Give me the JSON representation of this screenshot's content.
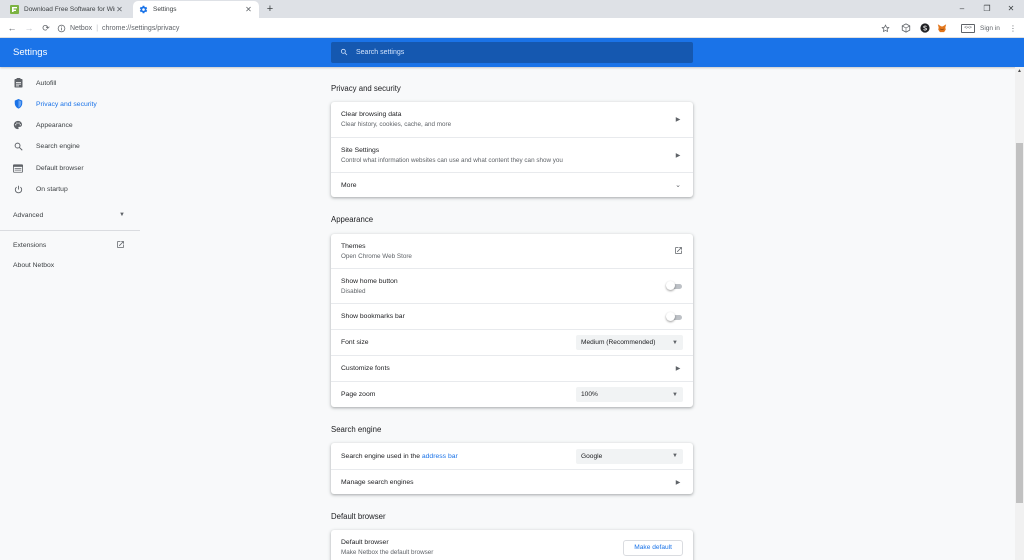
{
  "tabs": [
    {
      "title": "Download Free Software for Wind",
      "close": "✕"
    },
    {
      "title": "Settings",
      "close": "✕"
    }
  ],
  "new_tab": "+",
  "window_controls": {
    "minimize": "–",
    "restore": "❐",
    "close": "✕"
  },
  "toolbar": {
    "back": "←",
    "forward": "→",
    "reload": "⟳",
    "site_name": "Netbox",
    "separator": "|",
    "url": "chrome://settings/privacy",
    "sign_in": "Sign in",
    "menu": "⋮"
  },
  "header": {
    "title": "Settings",
    "search_placeholder": "Search settings"
  },
  "sidebar": {
    "items": [
      {
        "label": "Autofill",
        "icon": "clipboard-icon"
      },
      {
        "label": "Privacy and security",
        "icon": "shield-icon"
      },
      {
        "label": "Appearance",
        "icon": "palette-icon"
      },
      {
        "label": "Search engine",
        "icon": "search-icon"
      },
      {
        "label": "Default browser",
        "icon": "browser-icon"
      },
      {
        "label": "On startup",
        "icon": "power-icon"
      }
    ],
    "advanced": "Advanced",
    "extensions": "Extensions",
    "about": "About Netbox"
  },
  "privacy": {
    "title": "Privacy and security",
    "clear_browsing": {
      "primary": "Clear browsing data",
      "secondary": "Clear history, cookies, cache, and more"
    },
    "site_settings": {
      "primary": "Site Settings",
      "secondary": "Control what information websites can use and what content they can show you"
    },
    "more": "More"
  },
  "appearance": {
    "title": "Appearance",
    "themes": {
      "primary": "Themes",
      "secondary": "Open Chrome Web Store"
    },
    "home_button": {
      "primary": "Show home button",
      "secondary": "Disabled",
      "enabled": false
    },
    "bookmarks_bar": {
      "primary": "Show bookmarks bar",
      "enabled": false
    },
    "font_size": {
      "label": "Font size",
      "value": "Medium (Recommended)"
    },
    "customize_fonts": "Customize fonts",
    "page_zoom": {
      "label": "Page zoom",
      "value": "100%"
    }
  },
  "search_engine": {
    "title": "Search engine",
    "used_prefix": "Search engine used in the ",
    "used_link": "address bar",
    "value": "Google",
    "manage": "Manage search engines"
  },
  "default_browser": {
    "title": "Default browser",
    "primary": "Default browser",
    "secondary": "Make Netbox the default browser",
    "button": "Make default"
  },
  "colors": {
    "accent": "#1a73e8",
    "header_bg": "#1a73e8",
    "search_bg": "#1558b0",
    "page_bg": "#f8f9fa"
  }
}
